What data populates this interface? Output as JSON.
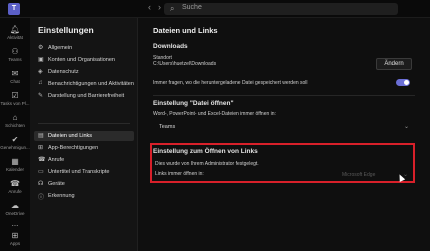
{
  "topbar": {
    "search_placeholder": "Suche"
  },
  "rail": [
    {
      "icon": "bell-icon",
      "label": "Aktivität"
    },
    {
      "icon": "teams-icon",
      "label": "Teams"
    },
    {
      "icon": "chat-icon",
      "label": "Chat"
    },
    {
      "icon": "tasks-icon",
      "label": "Tasks von Pl..."
    },
    {
      "icon": "school-icon",
      "label": "Schichten"
    },
    {
      "icon": "approval-icon",
      "label": "Genehmigun..."
    },
    {
      "icon": "calendar-icon",
      "label": "Kalender"
    },
    {
      "icon": "phone-icon",
      "label": "Anrufe"
    },
    {
      "icon": "cloud-icon",
      "label": "OneDrive"
    },
    {
      "icon": "more-icon",
      "label": "..."
    },
    {
      "icon": "apps-icon",
      "label": "Apps"
    }
  ],
  "nav": {
    "title": "Einstellungen",
    "items": [
      {
        "icon": "gear-icon",
        "label": "Allgemein"
      },
      {
        "icon": "accounts-icon",
        "label": "Konten und Organisationen"
      },
      {
        "icon": "privacy-icon",
        "label": "Datenschutz"
      },
      {
        "icon": "bell-icon",
        "label": "Benachrichtigungen und Aktivitäten"
      },
      {
        "icon": "accessibility-icon",
        "label": "Darstellung und Barrierefreiheit"
      },
      {
        "icon": "files-icon",
        "label": "Dateien und Links"
      },
      {
        "icon": "apps-icon",
        "label": "App-Berechtigungen"
      },
      {
        "icon": "phone-icon",
        "label": "Anrufe"
      },
      {
        "icon": "captions-icon",
        "label": "Untertitel und Transkripte"
      },
      {
        "icon": "devices-icon",
        "label": "Geräte"
      },
      {
        "icon": "info-icon",
        "label": "Erkennung"
      }
    ]
  },
  "main": {
    "title": "Dateien und Links",
    "downloads": {
      "title": "Downloads",
      "location_label": "Standort",
      "path": "C:\\Users\\huetzel\\Downloads",
      "change_label": "Ändern",
      "ask_text": "Immer fragen, wo die heruntergeladene Datei gespeichert werden soll"
    },
    "open_files": {
      "title": "Einstellung \"Datei öffnen\"",
      "desc": "Word-, PowerPoint- und Excel-Dateien immer öffnen in:",
      "value": "Teams"
    },
    "open_links": {
      "title": "Einstellung zum Öffnen von Links",
      "admin_note": "Dies wurde von Ihrem Administrator festgelegt.",
      "label": "Links immer öffnen in:",
      "value": "Microsoft Edge"
    }
  },
  "colors": {
    "accent": "#6b6fd6",
    "highlight_border": "#d8202a"
  }
}
